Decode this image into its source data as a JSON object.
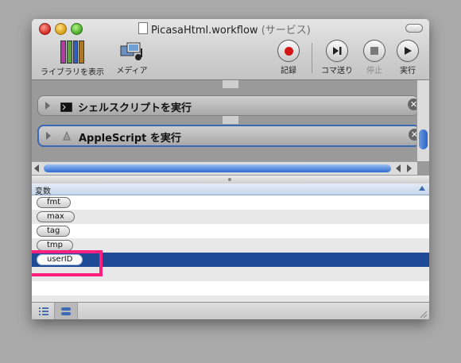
{
  "window": {
    "title": "PicasaHtml.workflow",
    "subtitle": "(サービス)"
  },
  "toolbar": {
    "library_label": "ライブラリを表示",
    "media_label": "メディア",
    "record_label": "記録",
    "step_label": "コマ送り",
    "stop_label": "停止",
    "run_label": "実行"
  },
  "actions": [
    {
      "name": "シェルスクリプトを実行",
      "icon": "terminal-icon"
    },
    {
      "name": "AppleScript を実行",
      "icon": "applescript-icon"
    }
  ],
  "variables": {
    "header": "変数",
    "items": [
      {
        "name": "fmt"
      },
      {
        "name": "max"
      },
      {
        "name": "tag"
      },
      {
        "name": "tmp"
      },
      {
        "name": "userID",
        "selected": true
      }
    ]
  },
  "colors": {
    "selection": "#1f4a96",
    "highlight": "#ff1f7c"
  }
}
